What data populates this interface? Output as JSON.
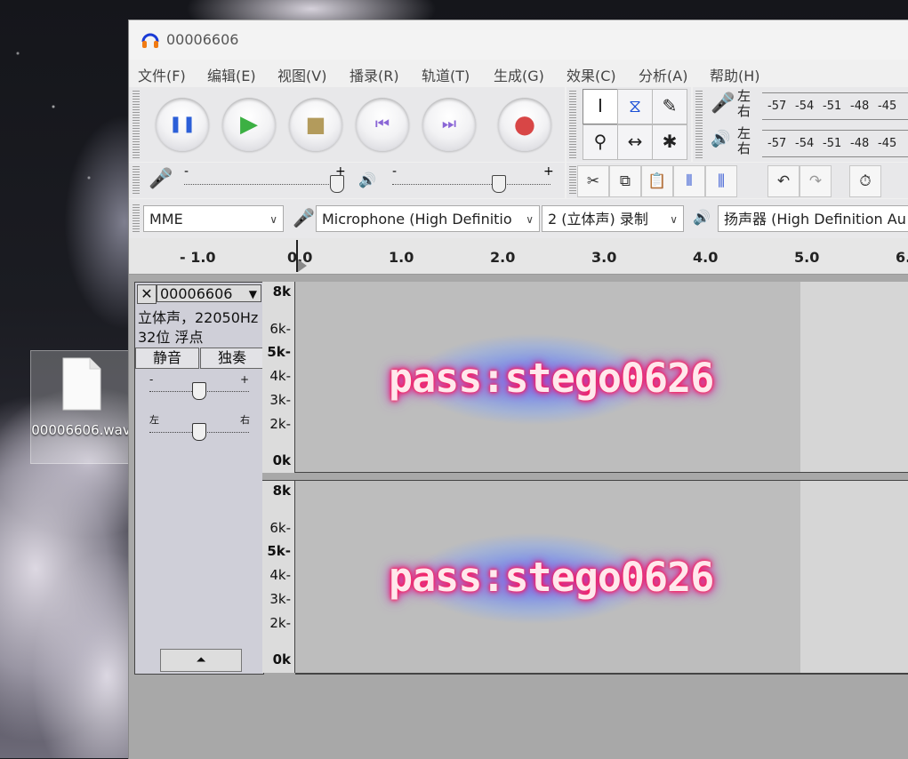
{
  "desktop": {
    "file_icon_label": "00006606.wav"
  },
  "window": {
    "title": "00006606"
  },
  "menu": [
    "文件(F)",
    "编辑(E)",
    "视图(V)",
    "播录(R)",
    "轨道(T)",
    "生成(G)",
    "效果(C)",
    "分析(A)",
    "帮助(H)"
  ],
  "meters": {
    "record_lr": "左\n右",
    "play_lr": "左\n右",
    "ticks": [
      "-57",
      "-54",
      "-51",
      "-48",
      "-45"
    ]
  },
  "mixer": {
    "minus": "-",
    "plus": "+"
  },
  "device": {
    "host": "MME",
    "input": "Microphone (High Definitio",
    "channels": "2 (立体声) 录制",
    "output": "扬声器 (High Definition Au"
  },
  "ruler": {
    "ticks": [
      "- 1.0",
      "0.0",
      "1.0",
      "2.0",
      "3.0",
      "4.0",
      "5.0",
      "6."
    ]
  },
  "track": {
    "name": "00006606",
    "close": "✕",
    "info_line1": "立体声，22050Hz",
    "info_line2": "32位 浮点",
    "mute": "静音",
    "solo": "独奏",
    "gain_minus": "-",
    "gain_plus": "+",
    "pan_left": "左",
    "pan_right": "右"
  },
  "spectrogram": {
    "scale": [
      "8k",
      "6k-",
      "5k-",
      "4k-",
      "3k-",
      "2k-",
      "0k"
    ],
    "hidden_text": "pass:stego0626"
  },
  "colors": {
    "window_bg": "#f0f0f0",
    "spectro_bg": "#bdbdbd",
    "text_glow": "#ff1f5a"
  }
}
